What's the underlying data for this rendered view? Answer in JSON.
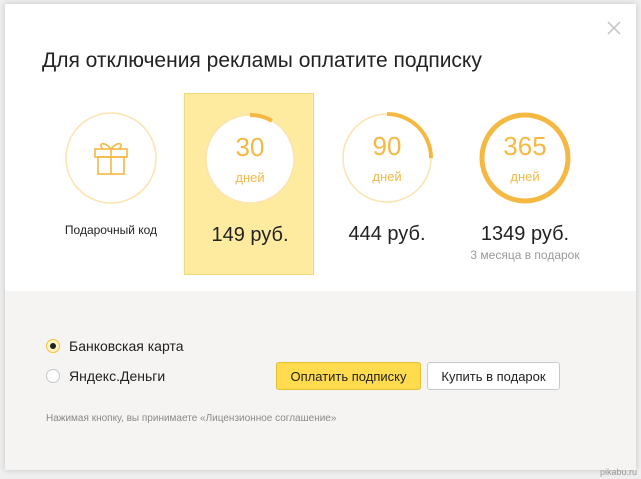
{
  "dialog": {
    "title": "Для отключения рекламы оплатите подписку",
    "close_icon": "close-icon"
  },
  "options": [
    {
      "id": "gift",
      "icon": "gift-icon",
      "label": "Подарочный код"
    },
    {
      "id": "30",
      "days": "30",
      "unit": "дней",
      "price": "149 руб.",
      "selected": true,
      "progress": 0.083
    },
    {
      "id": "90",
      "days": "90",
      "unit": "дней",
      "price": "444 руб.",
      "selected": false,
      "progress": 0.25
    },
    {
      "id": "365",
      "days": "365",
      "unit": "дней",
      "price": "1349 руб.",
      "bonus": "3 месяца в подарок",
      "selected": false,
      "progress": 1.0
    }
  ],
  "payment": {
    "methods": [
      {
        "label": "Банковская карта",
        "checked": true
      },
      {
        "label": "Яндекс.Деньги",
        "checked": false
      }
    ],
    "pay_button": "Оплатить подписку",
    "gift_button": "Купить в подарок",
    "license_note": "Нажимая кнопку, вы принимаете «Лицензионное соглашение»"
  },
  "watermark": "pikabu.ru",
  "colors": {
    "accent": "#f5b843",
    "ring_track": "#fbe3ae",
    "selected_bg": "#ffeba0",
    "button_yellow": "#ffdb4d"
  }
}
